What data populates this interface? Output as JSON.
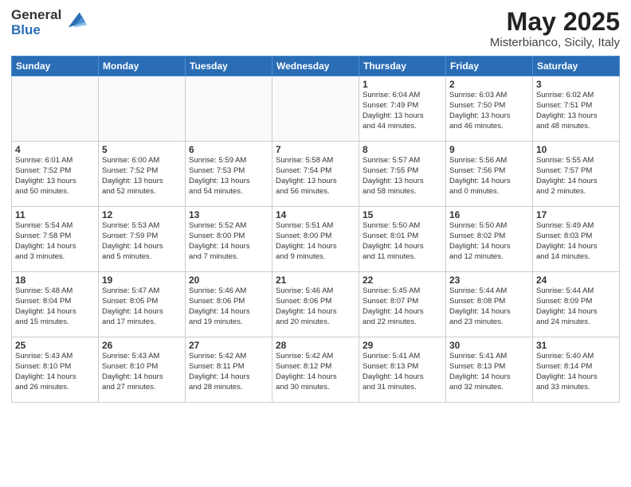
{
  "logo": {
    "general": "General",
    "blue": "Blue"
  },
  "title": "May 2025",
  "location": "Misterbianco, Sicily, Italy",
  "weekdays": [
    "Sunday",
    "Monday",
    "Tuesday",
    "Wednesday",
    "Thursday",
    "Friday",
    "Saturday"
  ],
  "weeks": [
    [
      {
        "day": "",
        "info": ""
      },
      {
        "day": "",
        "info": ""
      },
      {
        "day": "",
        "info": ""
      },
      {
        "day": "",
        "info": ""
      },
      {
        "day": "1",
        "info": "Sunrise: 6:04 AM\nSunset: 7:49 PM\nDaylight: 13 hours\nand 44 minutes."
      },
      {
        "day": "2",
        "info": "Sunrise: 6:03 AM\nSunset: 7:50 PM\nDaylight: 13 hours\nand 46 minutes."
      },
      {
        "day": "3",
        "info": "Sunrise: 6:02 AM\nSunset: 7:51 PM\nDaylight: 13 hours\nand 48 minutes."
      }
    ],
    [
      {
        "day": "4",
        "info": "Sunrise: 6:01 AM\nSunset: 7:52 PM\nDaylight: 13 hours\nand 50 minutes."
      },
      {
        "day": "5",
        "info": "Sunrise: 6:00 AM\nSunset: 7:52 PM\nDaylight: 13 hours\nand 52 minutes."
      },
      {
        "day": "6",
        "info": "Sunrise: 5:59 AM\nSunset: 7:53 PM\nDaylight: 13 hours\nand 54 minutes."
      },
      {
        "day": "7",
        "info": "Sunrise: 5:58 AM\nSunset: 7:54 PM\nDaylight: 13 hours\nand 56 minutes."
      },
      {
        "day": "8",
        "info": "Sunrise: 5:57 AM\nSunset: 7:55 PM\nDaylight: 13 hours\nand 58 minutes."
      },
      {
        "day": "9",
        "info": "Sunrise: 5:56 AM\nSunset: 7:56 PM\nDaylight: 14 hours\nand 0 minutes."
      },
      {
        "day": "10",
        "info": "Sunrise: 5:55 AM\nSunset: 7:57 PM\nDaylight: 14 hours\nand 2 minutes."
      }
    ],
    [
      {
        "day": "11",
        "info": "Sunrise: 5:54 AM\nSunset: 7:58 PM\nDaylight: 14 hours\nand 3 minutes."
      },
      {
        "day": "12",
        "info": "Sunrise: 5:53 AM\nSunset: 7:59 PM\nDaylight: 14 hours\nand 5 minutes."
      },
      {
        "day": "13",
        "info": "Sunrise: 5:52 AM\nSunset: 8:00 PM\nDaylight: 14 hours\nand 7 minutes."
      },
      {
        "day": "14",
        "info": "Sunrise: 5:51 AM\nSunset: 8:00 PM\nDaylight: 14 hours\nand 9 minutes."
      },
      {
        "day": "15",
        "info": "Sunrise: 5:50 AM\nSunset: 8:01 PM\nDaylight: 14 hours\nand 11 minutes."
      },
      {
        "day": "16",
        "info": "Sunrise: 5:50 AM\nSunset: 8:02 PM\nDaylight: 14 hours\nand 12 minutes."
      },
      {
        "day": "17",
        "info": "Sunrise: 5:49 AM\nSunset: 8:03 PM\nDaylight: 14 hours\nand 14 minutes."
      }
    ],
    [
      {
        "day": "18",
        "info": "Sunrise: 5:48 AM\nSunset: 8:04 PM\nDaylight: 14 hours\nand 15 minutes."
      },
      {
        "day": "19",
        "info": "Sunrise: 5:47 AM\nSunset: 8:05 PM\nDaylight: 14 hours\nand 17 minutes."
      },
      {
        "day": "20",
        "info": "Sunrise: 5:46 AM\nSunset: 8:06 PM\nDaylight: 14 hours\nand 19 minutes."
      },
      {
        "day": "21",
        "info": "Sunrise: 5:46 AM\nSunset: 8:06 PM\nDaylight: 14 hours\nand 20 minutes."
      },
      {
        "day": "22",
        "info": "Sunrise: 5:45 AM\nSunset: 8:07 PM\nDaylight: 14 hours\nand 22 minutes."
      },
      {
        "day": "23",
        "info": "Sunrise: 5:44 AM\nSunset: 8:08 PM\nDaylight: 14 hours\nand 23 minutes."
      },
      {
        "day": "24",
        "info": "Sunrise: 5:44 AM\nSunset: 8:09 PM\nDaylight: 14 hours\nand 24 minutes."
      }
    ],
    [
      {
        "day": "25",
        "info": "Sunrise: 5:43 AM\nSunset: 8:10 PM\nDaylight: 14 hours\nand 26 minutes."
      },
      {
        "day": "26",
        "info": "Sunrise: 5:43 AM\nSunset: 8:10 PM\nDaylight: 14 hours\nand 27 minutes."
      },
      {
        "day": "27",
        "info": "Sunrise: 5:42 AM\nSunset: 8:11 PM\nDaylight: 14 hours\nand 28 minutes."
      },
      {
        "day": "28",
        "info": "Sunrise: 5:42 AM\nSunset: 8:12 PM\nDaylight: 14 hours\nand 30 minutes."
      },
      {
        "day": "29",
        "info": "Sunrise: 5:41 AM\nSunset: 8:13 PM\nDaylight: 14 hours\nand 31 minutes."
      },
      {
        "day": "30",
        "info": "Sunrise: 5:41 AM\nSunset: 8:13 PM\nDaylight: 14 hours\nand 32 minutes."
      },
      {
        "day": "31",
        "info": "Sunrise: 5:40 AM\nSunset: 8:14 PM\nDaylight: 14 hours\nand 33 minutes."
      }
    ]
  ]
}
